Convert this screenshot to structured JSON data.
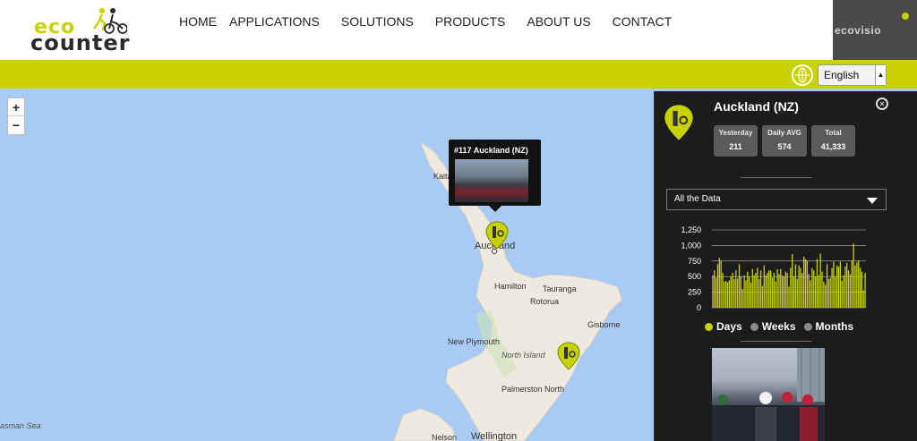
{
  "header": {
    "logo": {
      "line1": "eco",
      "line2": "counter"
    },
    "nav": [
      "HOME",
      "APPLICATIONS",
      "SOLUTIONS",
      "PRODUCTS",
      "ABOUT US",
      "CONTACT"
    ],
    "ecovisio_label": "ecovisio"
  },
  "language": {
    "selected": "English"
  },
  "map": {
    "zoom_in": "+",
    "zoom_out": "−",
    "labels": {
      "kaitaia": "Kaita",
      "auckland": "Auckland",
      "hamilton": "Hamilton",
      "tauranga": "Tauranga",
      "rotorua": "Rotorua",
      "gisborne": "Gisborne",
      "new_plymouth": "New Plymouth",
      "north_island": "North Island",
      "palmerston_north": "Palmerston North",
      "tasman_sea": "asman Sea",
      "nelson": "Nelson",
      "wellington": "Wellington"
    },
    "popup": {
      "title": "#117 Auckland (NZ)"
    }
  },
  "panel": {
    "title": "Auckland (NZ)",
    "stats": [
      {
        "label": "Yesterday",
        "value": "211"
      },
      {
        "label": "Daily AVG",
        "value": "574"
      },
      {
        "label": "Total",
        "value": "41,333"
      }
    ],
    "dropdown": "All the Data",
    "legend": [
      {
        "label": "Days",
        "color": "#c8d200"
      },
      {
        "label": "Weeks",
        "color": "#8a8a8a"
      },
      {
        "label": "Months",
        "color": "#8a8a8a"
      }
    ]
  },
  "colors": {
    "accent": "#c8d200",
    "panel_bg": "#1c1c1c"
  },
  "chart_data": {
    "type": "bar",
    "ylim": [
      0,
      1250
    ],
    "yticks": [
      "1,250",
      "1,000",
      "750",
      "500",
      "250",
      "0"
    ],
    "grid": true,
    "values": [
      520,
      600,
      480,
      700,
      800,
      760,
      560,
      420,
      430,
      410,
      440,
      500,
      560,
      460,
      600,
      470,
      700,
      510,
      300,
      520,
      440,
      580,
      500,
      400,
      620,
      520,
      560,
      640,
      460,
      600,
      350,
      680,
      520,
      560,
      600,
      600,
      480,
      560,
      420,
      620,
      540,
      620,
      520,
      500,
      580,
      560,
      340,
      640,
      860,
      500,
      700,
      460,
      680,
      640,
      560,
      820,
      780,
      760,
      540,
      440,
      640,
      600,
      500,
      780,
      520,
      870,
      580,
      420,
      370,
      700,
      460,
      480,
      640,
      740,
      500,
      680,
      660,
      740,
      430,
      520,
      660,
      720,
      600,
      540,
      760,
      1030,
      680,
      730,
      760,
      640,
      580,
      280,
      560
    ]
  }
}
